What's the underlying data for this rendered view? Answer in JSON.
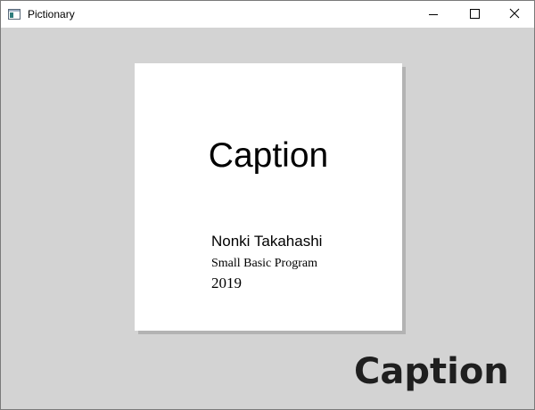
{
  "window": {
    "title": "Pictionary",
    "icon": "app-window-icon",
    "controls": {
      "minimize_icon": "minimize-icon",
      "maximize_icon": "maximize-icon",
      "close_icon": "close-icon"
    }
  },
  "card": {
    "caption": "Caption",
    "author": "Nonki Takahashi",
    "program": "Small Basic Program",
    "year": "2019"
  },
  "overlay": {
    "caption": "Caption"
  },
  "colors": {
    "background": "#d3d3d3",
    "card": "#ffffff",
    "card_shadow": "#b3b3b3",
    "titlebar": "#ffffff"
  }
}
